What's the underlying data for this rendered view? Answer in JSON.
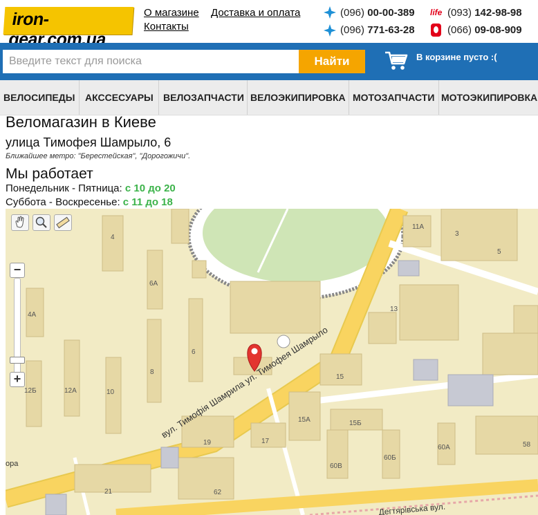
{
  "header": {
    "logo_text": "iron-gear.com.ua",
    "links": [
      "О магазине",
      "Доставка и оплата",
      "Контакты"
    ],
    "phones": [
      {
        "code": "(096)",
        "number": "00-00-389"
      },
      {
        "code": "(093)",
        "number": "142-98-98",
        "badge": "life"
      },
      {
        "code": "(096)",
        "number": "771-63-28"
      },
      {
        "code": "(066)",
        "number": "09-08-909"
      }
    ]
  },
  "search": {
    "placeholder": "Введите текст для поиска",
    "button": "Найти",
    "cart_text": "В корзине пусто :("
  },
  "nav": [
    "ВЕЛОСИПЕДЫ",
    "АКССЕСУАРЫ",
    "ВЕЛОЗАПЧАСТИ",
    "ВЕЛОЭКИПИРОВКА",
    "МОТОЗАПЧАСТИ",
    "МОТОЭКИПИРОВКА"
  ],
  "content": {
    "title": "Веломагазин в Киеве",
    "address": "улица Тимофея Шамрыло, 6",
    "metro": "Ближайшее метро: \"Берестейская\", \"Дорогожичи\".",
    "hours_title": "Мы работает",
    "weekdays_label": "Понедельник - Пятница:",
    "weekdays_hours": "с 10 до 20",
    "weekend_label": "Суббота - Воскресенье:",
    "weekend_hours": "с 11 до 18"
  },
  "map": {
    "street_label": "вул. Тимофія Шамрила ул. Тимофея Шамрыло",
    "street_label_2": "Дегтярівська вул.",
    "edge_label": "ора",
    "house_numbers": [
      "4",
      "6А",
      "4А",
      "6",
      "8",
      "12Б",
      "12А",
      "10",
      "19",
      "17",
      "21",
      "62",
      "15",
      "15А",
      "15Б",
      "60В",
      "60Б",
      "60А",
      "58",
      "13",
      "11А",
      "3",
      "5"
    ],
    "tools": [
      "hand-icon",
      "zoom-magnifier-icon",
      "ruler-icon"
    ],
    "colors": {
      "land": "#f2ebc5",
      "road": "#f9d460",
      "park": "#d6e9c0",
      "building": "#e8dba8"
    }
  }
}
